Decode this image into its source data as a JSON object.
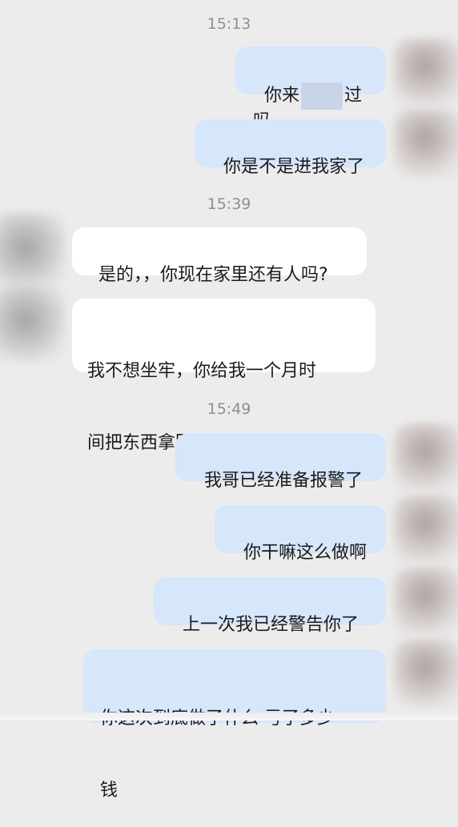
{
  "chat": {
    "timestamps": [
      "15:13",
      "15:39",
      "15:49"
    ],
    "messages": [
      {
        "side": "out",
        "before": "你来",
        "after": "过吗"
      },
      {
        "side": "out",
        "text": "你是不是进我家了"
      },
      {
        "side": "in",
        "text": "是的，，你现在家里还有人吗?"
      },
      {
        "side": "in",
        "lines": [
          "我不想坐牢，你给我一个月时",
          "间把东西拿回来行吗?"
        ]
      },
      {
        "side": "out",
        "text": "我哥已经准备报警了"
      },
      {
        "side": "out",
        "text": "你干嘛这么做啊"
      },
      {
        "side": "out",
        "text": "上一次我已经警告你了"
      },
      {
        "side": "out",
        "lines": [
          "你这次到底做了什么 亏了多少",
          "钱"
        ]
      }
    ]
  },
  "colors": {
    "background": "#ececec",
    "outgoing_bubble": "#d6e6fb",
    "incoming_bubble": "#ffffff",
    "timestamp_text": "#8f8f8f"
  }
}
